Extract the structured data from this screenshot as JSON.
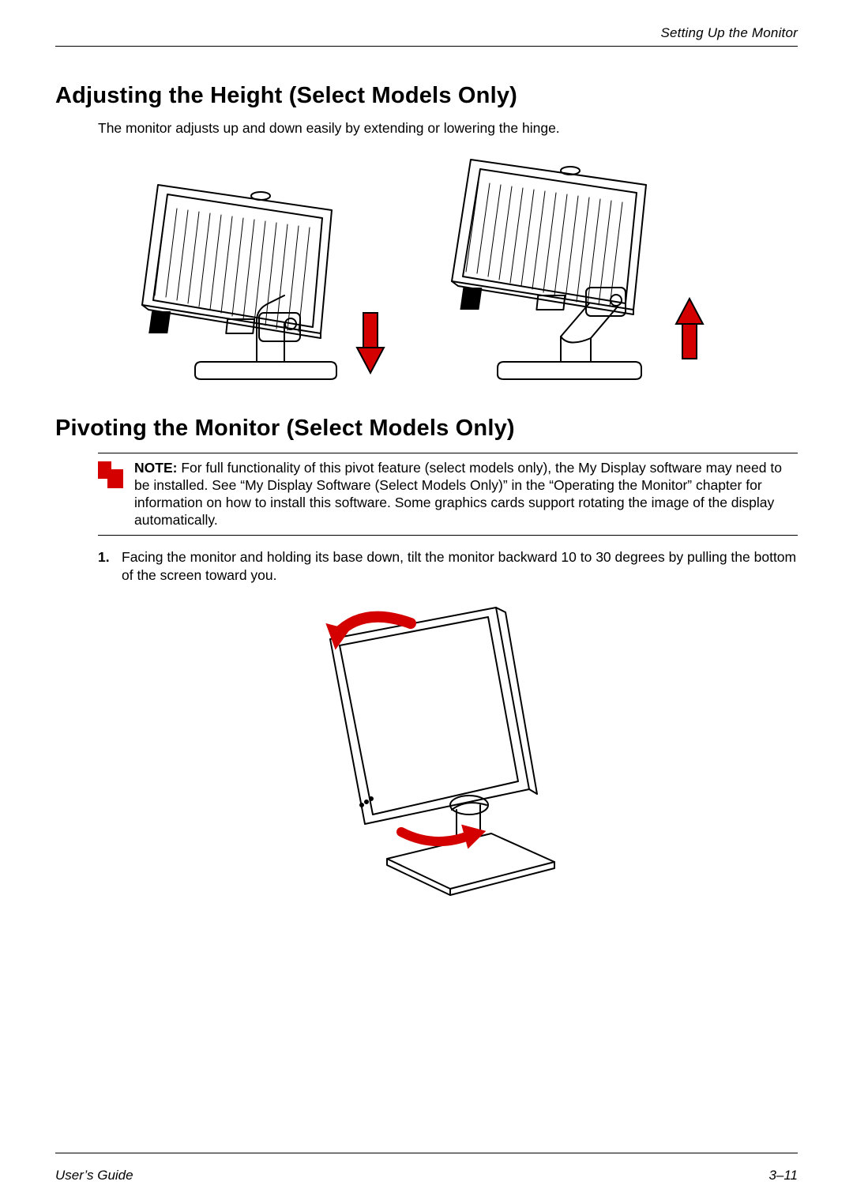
{
  "running_head": "Setting Up the Monitor",
  "section1": {
    "title": "Adjusting the Height (Select Models Only)",
    "body": "The monitor adjusts up and down easily by extending or lowering the hinge."
  },
  "section2": {
    "title": "Pivoting the Monitor (Select Models Only)",
    "note_label": "NOTE:",
    "note_text": " For full functionality of this pivot feature (select models only), the My Display software may need to be installed. See “My Display Software (Select Models Only)” in the “Operating the Monitor” chapter for information on how to install this software. Some graphics cards support rotating the image of the display automatically.",
    "step_num": "1.",
    "step_text": "Facing the monitor and holding its base down, tilt the monitor backward 10 to 30 degrees by pulling the bottom of the screen toward you."
  },
  "footer": {
    "left": "User’s Guide",
    "right": "3–11"
  }
}
